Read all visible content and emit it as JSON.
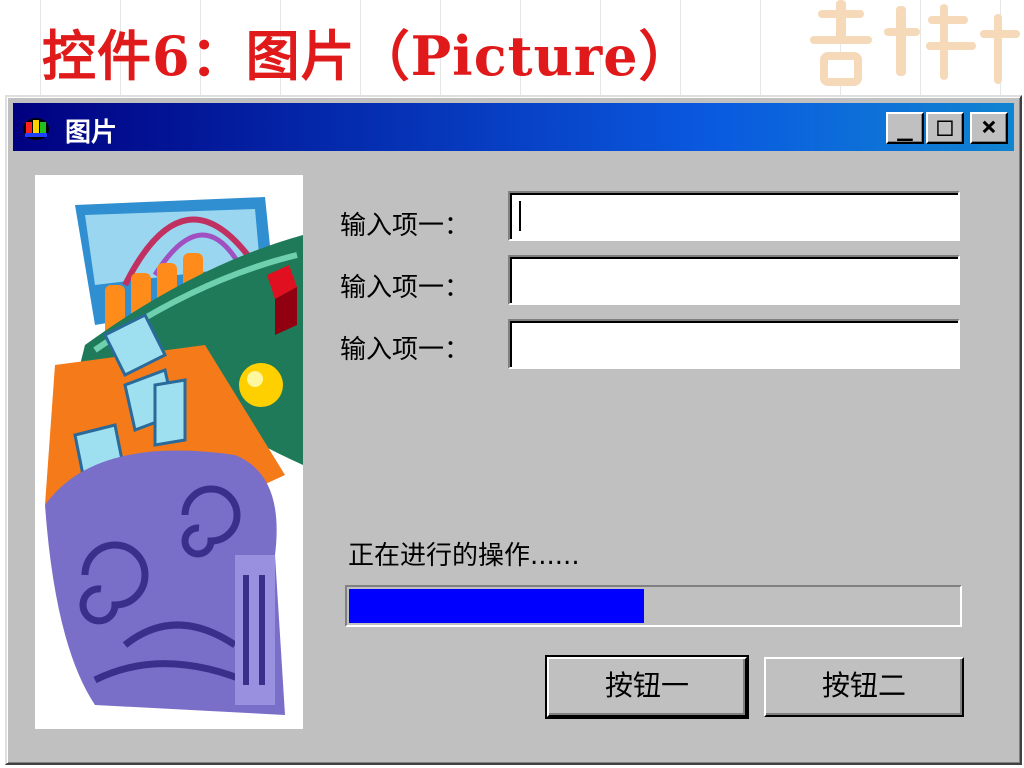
{
  "slide": {
    "title": "控件6：图片（Picture）"
  },
  "window": {
    "title": "图片",
    "controls": {
      "minimize": "_",
      "maximize": "□",
      "close": "×"
    }
  },
  "form": {
    "fields": [
      {
        "label": "输入项一：",
        "value": ""
      },
      {
        "label": "输入项一：",
        "value": ""
      },
      {
        "label": "输入项一：",
        "value": ""
      }
    ],
    "status_text": "正在进行的操作......",
    "progress_fraction": 0.485,
    "buttons": [
      {
        "label": "按钮一"
      },
      {
        "label": "按钮二"
      }
    ]
  },
  "colors": {
    "title_red": "#e01a1a",
    "titlebar_start": "#000080",
    "progress_fill": "#0000ff",
    "window_face": "#c0c0c0"
  },
  "icons": {
    "window_icon": "app-icon",
    "decoration": "auspicious-calligraphy-decoration"
  }
}
